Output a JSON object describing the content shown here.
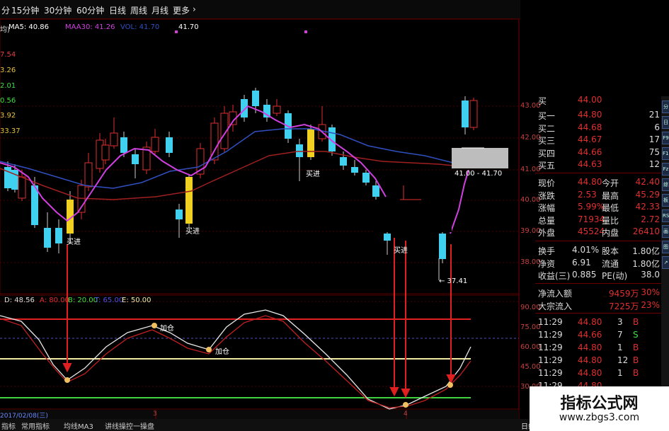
{
  "toolbar": {
    "items": [
      "分",
      "15分钟",
      "30分钟",
      "60分钟",
      "日线",
      "周线",
      "月线",
      "更多"
    ],
    "more_arrow": "›"
  },
  "ma_legend": {
    "prefix": "均)",
    "ma5": "MA5: 40.86",
    "ma30": "MAA30: 41.26",
    "vol": "VOL: 41.70",
    "extra": "41.70"
  },
  "left_labels": [
    "7.54",
    "3.26",
    "2.01",
    "0.56",
    "3.92",
    "33.37"
  ],
  "price_axis": [
    "43.00",
    "42.00",
    "41.00",
    "40.00",
    "39.00",
    "38.00"
  ],
  "osc_axis": [
    "90.00",
    "75.00",
    "60.00",
    "45.00",
    "30.00"
  ],
  "annotations": {
    "buy1": "买进",
    "buy2": "买进",
    "buy3": "买进",
    "buy4": "买进",
    "add1": "加仓",
    "add2": "加仓",
    "range_label": "41.00 - 41.70",
    "low_label": "← 37.41"
  },
  "osc_legend": {
    "d": "D: 48.56",
    "a": "A: 80.00",
    "b": "B: 20.00",
    "t": "T: 65.00",
    "e": "E: 50.00"
  },
  "date_bar": {
    "date": "2017/02/08(三)",
    "m1": "3",
    "m2": "4"
  },
  "order_book": [
    {
      "label": "买一",
      "price": "44.80",
      "vol": "21"
    },
    {
      "label": "买二",
      "price": "44.68",
      "vol": "6"
    },
    {
      "label": "买三",
      "price": "44.67",
      "vol": "17"
    },
    {
      "label": "买四",
      "price": "44.66",
      "vol": "75"
    },
    {
      "label": "买五",
      "price": "44.63",
      "vol": "12"
    }
  ],
  "order_book_top": {
    "label": "买",
    "price": "44.00"
  },
  "quote": [
    {
      "l1": "现价",
      "v1": "44.80",
      "l2": "今开",
      "v2": "42.40"
    },
    {
      "l1": "涨跌",
      "v1": "2.53",
      "l2": "最高",
      "v2": "45.29"
    },
    {
      "l1": "涨幅",
      "v1": "5.99%",
      "l2": "最低",
      "v2": "42.33"
    },
    {
      "l1": "总量",
      "v1": "71934",
      "l2": "量比",
      "v2": "2.72"
    },
    {
      "l1": "外盘",
      "v1": "45524",
      "l2": "内盘",
      "v2": "26410"
    }
  ],
  "fund": [
    {
      "l1": "换手",
      "v1": "4.01%",
      "l2": "股本",
      "v2": "1.80亿"
    },
    {
      "l1": "净资",
      "v1": "6.91",
      "l2": "流通",
      "v2": "1.80亿"
    },
    {
      "l1": "收益(三)",
      "v1": "0.885",
      "l2": "PE(动)",
      "v2": "38.0"
    }
  ],
  "flow": [
    {
      "label": "净流入额",
      "value": "9459万",
      "pct": "30%"
    },
    {
      "label": "大宗流入",
      "value": "7225万",
      "pct": "23%"
    }
  ],
  "ticks": [
    {
      "time": "11:29",
      "price": "44.80",
      "vol": "3",
      "side": "B"
    },
    {
      "time": "11:29",
      "price": "44.66",
      "vol": "7",
      "side": "S"
    },
    {
      "time": "11:29",
      "price": "44.80",
      "vol": "1",
      "side": "B"
    },
    {
      "time": "11:29",
      "price": "44.80",
      "vol": "12",
      "side": "B"
    },
    {
      "time": "11:29",
      "price": "44.80",
      "vol": "1",
      "side": "B"
    },
    {
      "time": "11:29",
      "price": "44.80",
      "vol": "",
      "side": ""
    }
  ],
  "side_icons": [
    "分",
    "日",
    "F9",
    "F10",
    "Fz",
    "综",
    "板",
    "RSI",
    "画",
    "图",
    "↗"
  ],
  "bottom_tabs": [
    "指标",
    "常用指标",
    "均线MA3",
    "讲线操控一操盘"
  ],
  "bottom_right": "日线",
  "watermark": {
    "title": "指标公式网",
    "url": "www.zbgs3.com"
  },
  "colors": {
    "up": "#e03030",
    "down": "#40d0f0",
    "yellow": "#f0d020",
    "magenta": "#d040e0",
    "blue": "#3050c0"
  }
}
